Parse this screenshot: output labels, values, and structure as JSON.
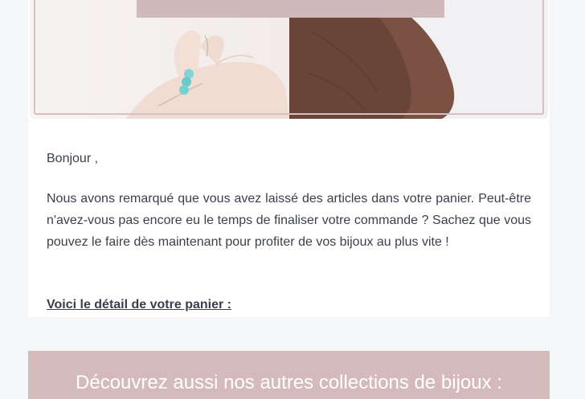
{
  "hero": {
    "images": [
      "bracelet-photo",
      "hand-photo"
    ]
  },
  "email": {
    "greeting": "Bonjour   ,",
    "paragraph": "Nous avons remarqué que vous avez laissé des articles dans votre panier. Peut-être n'avez-vous pas encore eu le temps de finaliser votre commande ? Sachez que vous pouvez le faire dès maintenant pour profiter de vos bijoux au plus vite !",
    "cart_heading": "Voici le détail de votre panier : "
  },
  "collections": {
    "title": "Découvrez aussi nos autres collections de bijoux :"
  },
  "colors": {
    "accent": "#d5babb",
    "text": "#3b3f4a",
    "background": "#f5f6f8"
  }
}
